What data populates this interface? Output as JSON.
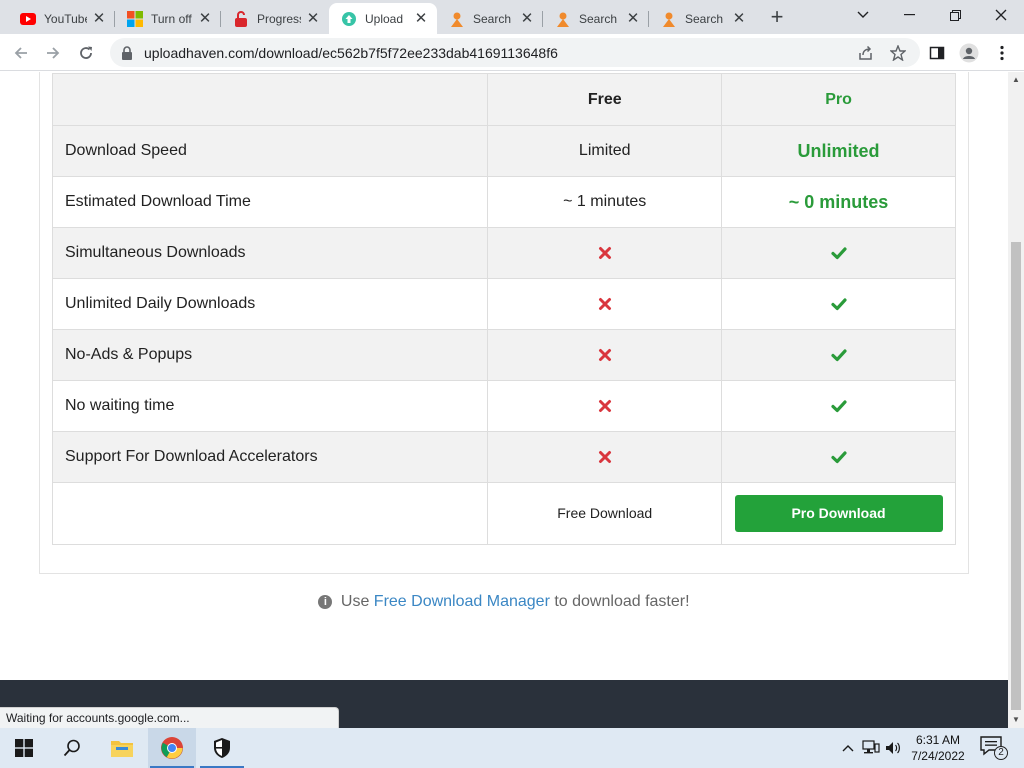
{
  "browser": {
    "tabs": [
      {
        "title": "YouTube",
        "icon": "youtube-icon"
      },
      {
        "title": "Turn off",
        "icon": "microsoft-icon"
      },
      {
        "title": "Progress",
        "icon": "progress-icon"
      },
      {
        "title": "Upload",
        "icon": "uploadhaven-icon"
      },
      {
        "title": "Search",
        "icon": "search-site-icon"
      },
      {
        "title": "Search",
        "icon": "search-site-icon"
      },
      {
        "title": "Search",
        "icon": "search-site-icon"
      }
    ],
    "url": "uploadhaven.com/download/ec562b7f5f72ee233dab4169113648f6"
  },
  "table": {
    "headers": {
      "free": "Free",
      "pro": "Pro"
    },
    "rows": [
      {
        "feature": "Download Speed",
        "free": "Limited",
        "pro": "Unlimited"
      },
      {
        "feature": "Estimated Download Time",
        "free": "~ 1 minutes",
        "pro": "~ 0 minutes"
      },
      {
        "feature": "Simultaneous Downloads"
      },
      {
        "feature": "Unlimited Daily Downloads"
      },
      {
        "feature": "No-Ads & Popups"
      },
      {
        "feature": "No waiting time"
      },
      {
        "feature": "Support For Download Accelerators"
      }
    ],
    "free_download_label": "Free Download",
    "pro_download_label": "Pro Download"
  },
  "hint": {
    "prefix": "Use",
    "link": "Free Download Manager",
    "suffix": "to download faster!"
  },
  "status_text": "Waiting for accounts.google.com...",
  "taskbar": {
    "time": "6:31 AM",
    "date": "7/24/2022",
    "notification_count": "2"
  },
  "colors": {
    "pro_green": "#2a9b3a",
    "button_green": "#23a23a",
    "cross_red": "#d9363e",
    "link_blue": "#3b87c4"
  }
}
